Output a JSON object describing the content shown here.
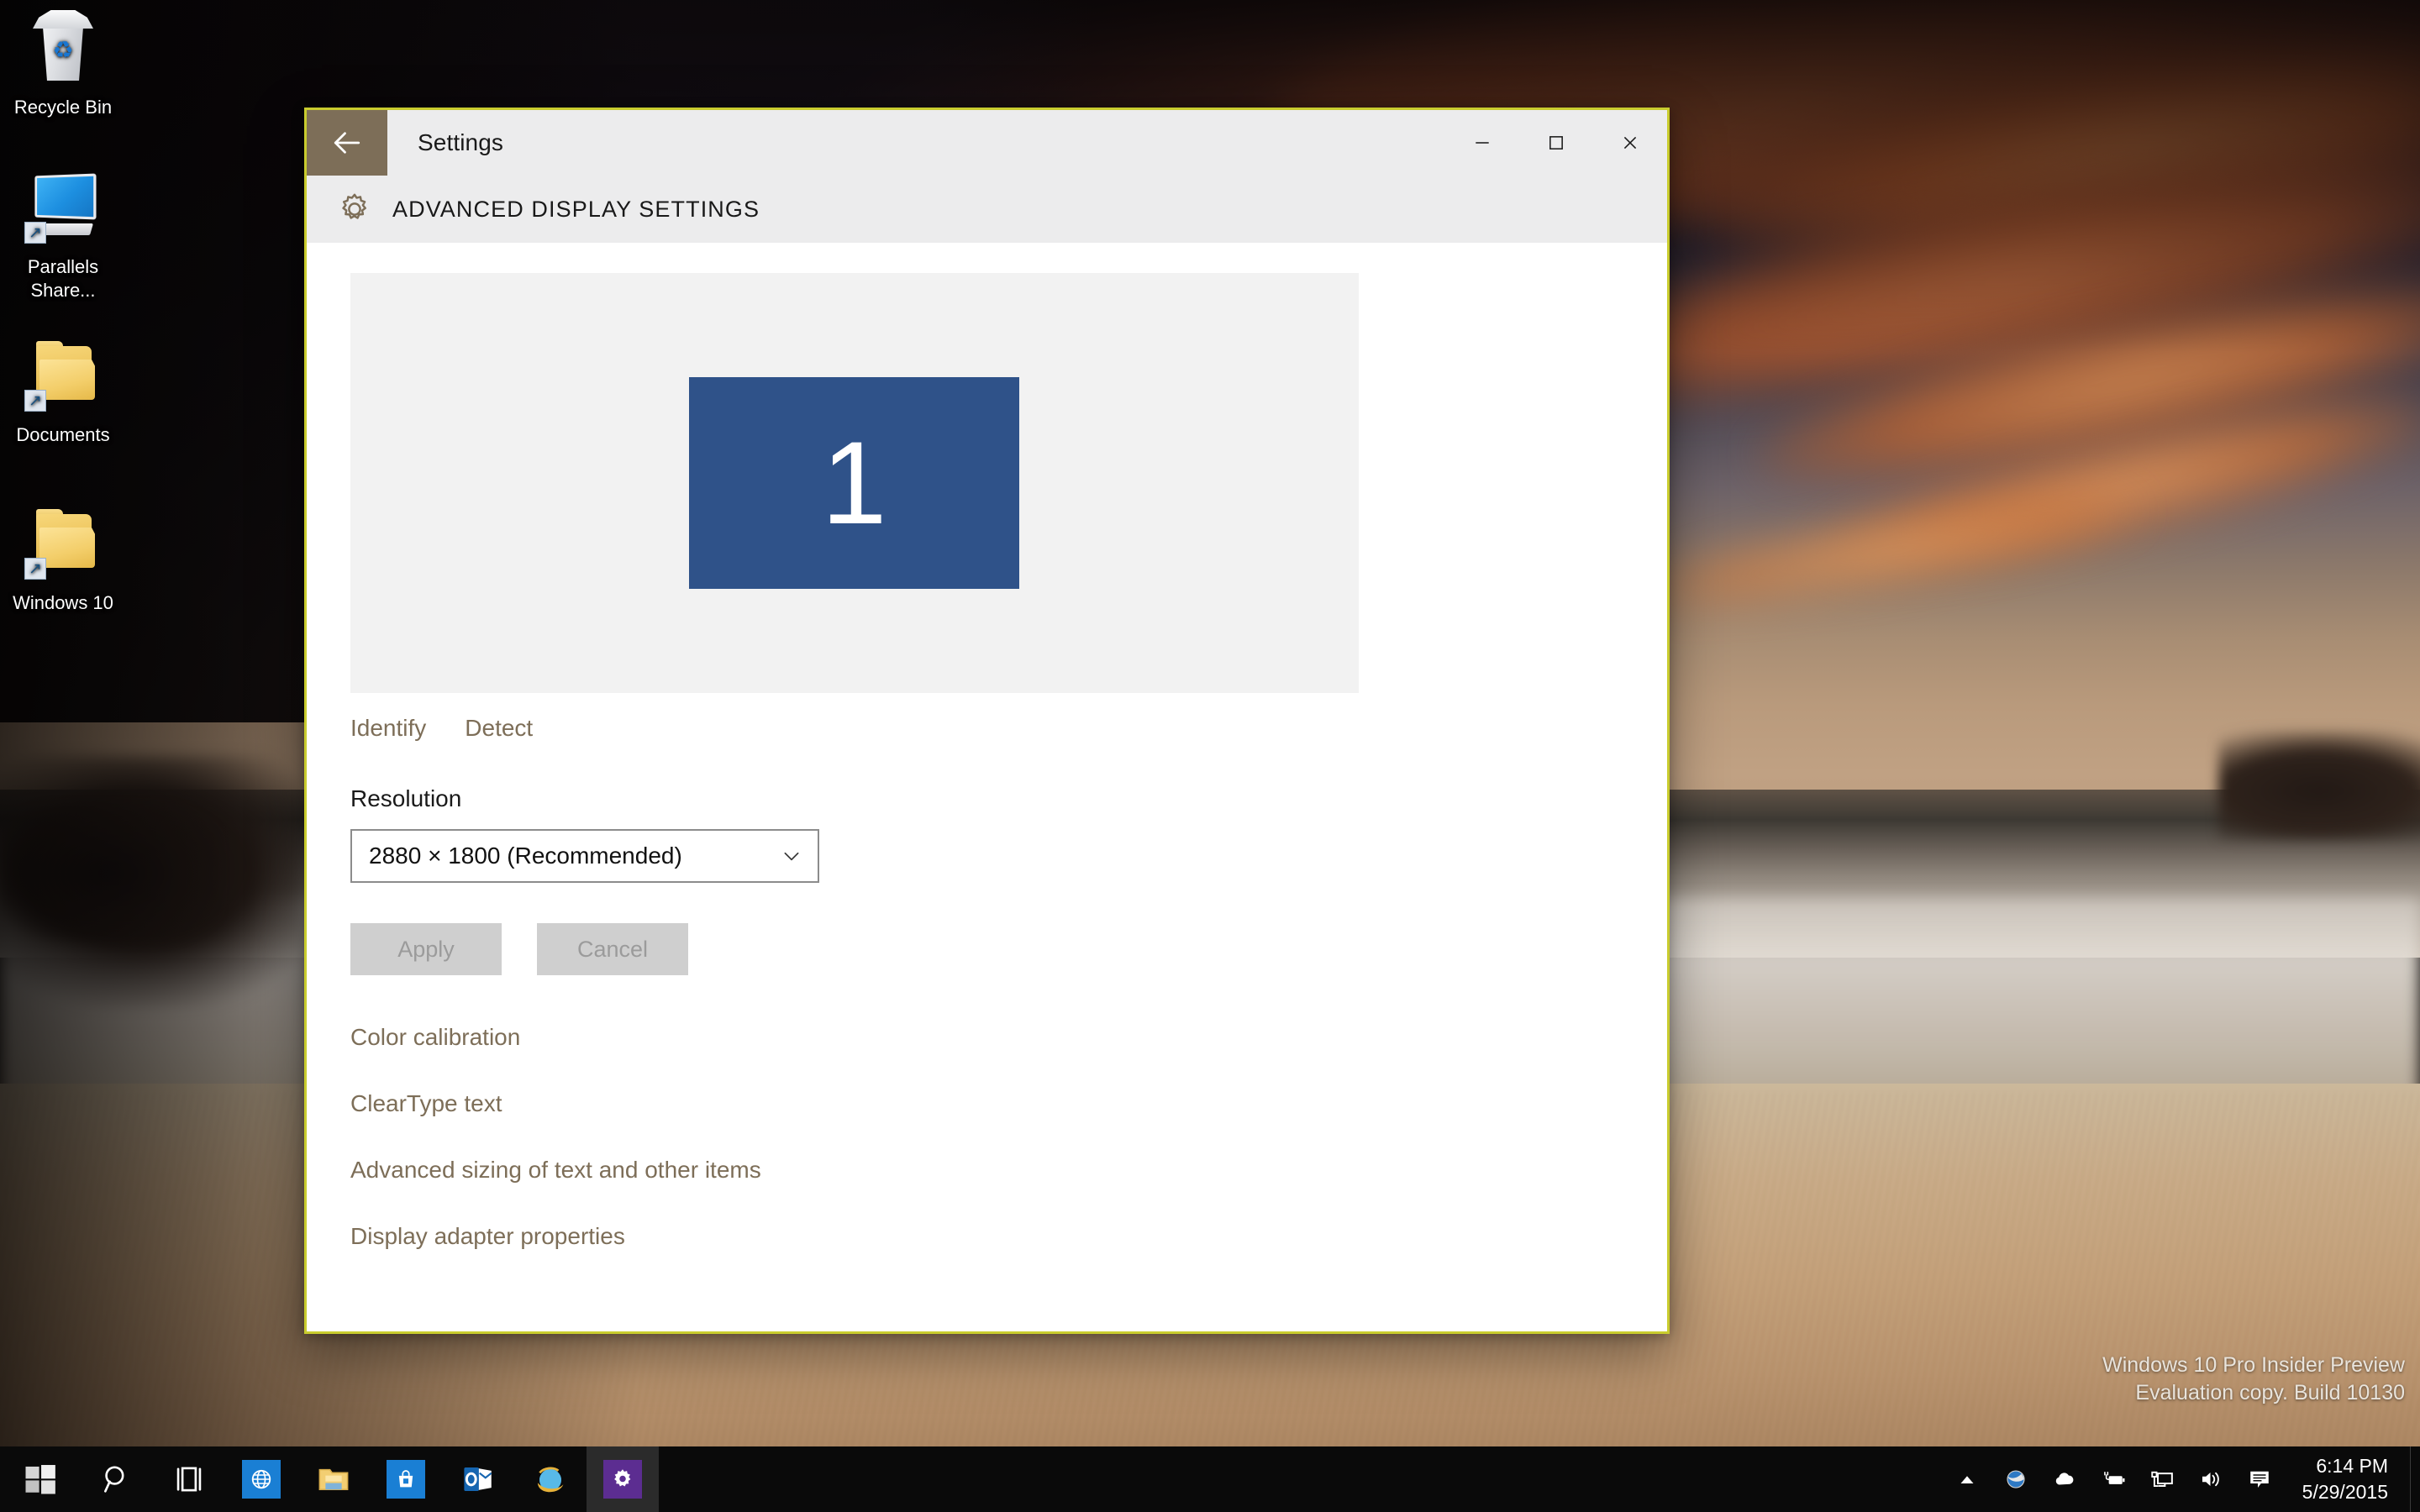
{
  "desktop": {
    "icons": [
      {
        "name": "recycle-bin",
        "label": "Recycle Bin",
        "type": "recycle"
      },
      {
        "name": "parallels-share",
        "label": "Parallels Share...",
        "type": "monitor"
      },
      {
        "name": "documents",
        "label": "Documents",
        "type": "folder"
      },
      {
        "name": "windows-10",
        "label": "Windows 10",
        "type": "folder"
      }
    ],
    "watermark": {
      "line1": "Windows 10 Pro Insider Preview",
      "line2": "Evaluation copy. Build 10130"
    }
  },
  "window": {
    "app_title": "Settings",
    "back_label": "Back",
    "header_title": "ADVANCED DISPLAY SETTINGS",
    "accent_border": "#c9cc2e",
    "chrome_color": "#7d6e58",
    "controls": {
      "minimize": "Minimize",
      "maximize": "Maximize",
      "close": "Close"
    }
  },
  "main": {
    "monitor": {
      "number": "1",
      "color": "#2f5289"
    },
    "identify_label": "Identify",
    "detect_label": "Detect",
    "resolution_label": "Resolution",
    "resolution_value": "2880 × 1800 (Recommended)",
    "apply_label": "Apply",
    "cancel_label": "Cancel",
    "links": [
      "Color calibration",
      "ClearType text",
      "Advanced sizing of text and other items",
      "Display adapter properties"
    ]
  },
  "taskbar": {
    "start_label": "Start",
    "items": [
      {
        "name": "search",
        "label": "Search"
      },
      {
        "name": "task-view",
        "label": "Task View"
      },
      {
        "name": "edge",
        "label": "Microsoft Edge"
      },
      {
        "name": "file-explorer",
        "label": "File Explorer"
      },
      {
        "name": "store",
        "label": "Store"
      },
      {
        "name": "outlook",
        "label": "Outlook"
      },
      {
        "name": "internet-explorer",
        "label": "Internet Explorer"
      },
      {
        "name": "settings",
        "label": "Settings"
      }
    ],
    "tray": [
      {
        "name": "show-hidden-icons",
        "label": "Show hidden icons"
      },
      {
        "name": "globe",
        "label": "Network globe"
      },
      {
        "name": "onedrive",
        "label": "OneDrive"
      },
      {
        "name": "battery",
        "label": "Battery"
      },
      {
        "name": "network",
        "label": "Network"
      },
      {
        "name": "volume",
        "label": "Volume"
      },
      {
        "name": "action-center",
        "label": "Action Center"
      }
    ],
    "clock": {
      "time": "6:14 PM",
      "date": "5/29/2015"
    }
  }
}
